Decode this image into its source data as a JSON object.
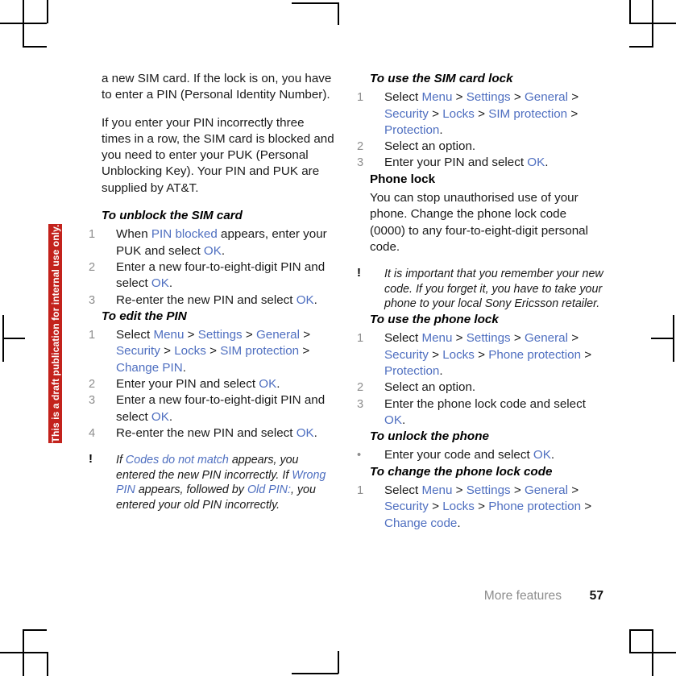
{
  "watermark": {
    "text": "This is a draft publication for internal use only.",
    "color": "#c3221c"
  },
  "colors": {
    "link": "#4f6fc0",
    "number": "#8d8d8d",
    "body": "#1a1a1a"
  },
  "left_column": {
    "paragraph_1": "a new SIM card. If the lock is on, you have to enter a PIN (Personal Identity Number).",
    "paragraph_2": "If you enter your PIN incorrectly three times in a row, the SIM card is blocked and you need to enter your PUK (Personal Unblocking Key). Your PIN and PUK are supplied by AT&T.",
    "section_unblock": {
      "heading": "To unblock the SIM card",
      "steps": [
        {
          "num": "1",
          "parts": [
            {
              "text": "When ",
              "style": "plain"
            },
            {
              "text": "PIN blocked",
              "style": "link"
            },
            {
              "text": " appears, enter your PUK and select ",
              "style": "plain"
            },
            {
              "text": "OK",
              "style": "link"
            },
            {
              "text": ".",
              "style": "plain"
            }
          ]
        },
        {
          "num": "2",
          "parts": [
            {
              "text": "Enter a new four-to-eight-digit PIN and select ",
              "style": "plain"
            },
            {
              "text": "OK",
              "style": "link"
            },
            {
              "text": ".",
              "style": "plain"
            }
          ]
        },
        {
          "num": "3",
          "parts": [
            {
              "text": "Re-enter the new PIN and select ",
              "style": "plain"
            },
            {
              "text": "OK",
              "style": "link"
            },
            {
              "text": ".",
              "style": "plain"
            }
          ]
        }
      ]
    },
    "section_edit_pin": {
      "heading": "To edit the PIN",
      "steps": [
        {
          "num": "1",
          "parts": [
            {
              "text": "Select ",
              "style": "plain"
            },
            {
              "text": "Menu",
              "style": "link"
            },
            {
              "text": " > ",
              "style": "sep"
            },
            {
              "text": "Settings",
              "style": "link"
            },
            {
              "text": " > ",
              "style": "sep"
            },
            {
              "text": "General",
              "style": "link"
            },
            {
              "text": " > ",
              "style": "sep"
            },
            {
              "text": "Security",
              "style": "link"
            },
            {
              "text": " > ",
              "style": "sep"
            },
            {
              "text": "Locks",
              "style": "link"
            },
            {
              "text": " > ",
              "style": "sep"
            },
            {
              "text": "SIM protection",
              "style": "link"
            },
            {
              "text": " > ",
              "style": "sep"
            },
            {
              "text": "Change PIN",
              "style": "link"
            },
            {
              "text": ".",
              "style": "plain"
            }
          ]
        },
        {
          "num": "2",
          "parts": [
            {
              "text": "Enter your PIN and select ",
              "style": "plain"
            },
            {
              "text": "OK",
              "style": "link"
            },
            {
              "text": ".",
              "style": "plain"
            }
          ]
        },
        {
          "num": "3",
          "parts": [
            {
              "text": "Enter a new four-to-eight-digit PIN and select ",
              "style": "plain"
            },
            {
              "text": "OK",
              "style": "link"
            },
            {
              "text": ".",
              "style": "plain"
            }
          ]
        },
        {
          "num": "4",
          "parts": [
            {
              "text": "Re-enter the new PIN and select ",
              "style": "plain"
            },
            {
              "text": "OK",
              "style": "link"
            },
            {
              "text": ".",
              "style": "plain"
            }
          ]
        }
      ]
    },
    "note": {
      "icon": "exclamation-icon",
      "parts": [
        {
          "text": "If ",
          "style": "plain"
        },
        {
          "text": "Codes do not match",
          "style": "link"
        },
        {
          "text": " appears, you entered the new PIN incorrectly. If ",
          "style": "plain"
        },
        {
          "text": "Wrong PIN",
          "style": "link"
        },
        {
          "text": " appears, followed by ",
          "style": "plain"
        },
        {
          "text": "Old PIN:",
          "style": "link"
        },
        {
          "text": ", you entered your old PIN incorrectly.",
          "style": "plain"
        }
      ]
    }
  },
  "right_column": {
    "section_sim_lock": {
      "heading": "To use the SIM card lock",
      "steps": [
        {
          "num": "1",
          "parts": [
            {
              "text": "Select ",
              "style": "plain"
            },
            {
              "text": "Menu",
              "style": "link"
            },
            {
              "text": " > ",
              "style": "sep"
            },
            {
              "text": "Settings",
              "style": "link"
            },
            {
              "text": " > ",
              "style": "sep"
            },
            {
              "text": "General",
              "style": "link"
            },
            {
              "text": " > ",
              "style": "sep"
            },
            {
              "text": "Security",
              "style": "link"
            },
            {
              "text": " > ",
              "style": "sep"
            },
            {
              "text": "Locks",
              "style": "link"
            },
            {
              "text": " > ",
              "style": "sep"
            },
            {
              "text": "SIM protection",
              "style": "link"
            },
            {
              "text": " > ",
              "style": "sep"
            },
            {
              "text": "Protection",
              "style": "link"
            },
            {
              "text": ".",
              "style": "plain"
            }
          ]
        },
        {
          "num": "2",
          "parts": [
            {
              "text": "Select an option.",
              "style": "plain"
            }
          ]
        },
        {
          "num": "3",
          "parts": [
            {
              "text": "Enter your PIN and select ",
              "style": "plain"
            },
            {
              "text": "OK",
              "style": "link"
            },
            {
              "text": ".",
              "style": "plain"
            }
          ]
        }
      ]
    },
    "section_phone_lock": {
      "heading": "Phone lock",
      "paragraph": "You can stop unauthorised use of your phone. Change the phone lock code (0000) to any four-to-eight-digit personal code.",
      "note": {
        "icon": "exclamation-icon",
        "parts": [
          {
            "text": "It is important that you remember your new code. If you forget it, you have to take your phone to your local Sony Ericsson retailer.",
            "style": "plain"
          }
        ]
      }
    },
    "section_use_phone_lock": {
      "heading": "To use the phone lock",
      "steps": [
        {
          "num": "1",
          "parts": [
            {
              "text": "Select ",
              "style": "plain"
            },
            {
              "text": "Menu",
              "style": "link"
            },
            {
              "text": " > ",
              "style": "sep"
            },
            {
              "text": "Settings",
              "style": "link"
            },
            {
              "text": " > ",
              "style": "sep"
            },
            {
              "text": "General",
              "style": "link"
            },
            {
              "text": " > ",
              "style": "sep"
            },
            {
              "text": "Security",
              "style": "link"
            },
            {
              "text": " > ",
              "style": "sep"
            },
            {
              "text": "Locks",
              "style": "link"
            },
            {
              "text": " > ",
              "style": "sep"
            },
            {
              "text": "Phone protection",
              "style": "link"
            },
            {
              "text": " > ",
              "style": "sep"
            },
            {
              "text": "Protection",
              "style": "link"
            },
            {
              "text": ".",
              "style": "plain"
            }
          ]
        },
        {
          "num": "2",
          "parts": [
            {
              "text": "Select an option.",
              "style": "plain"
            }
          ]
        },
        {
          "num": "3",
          "parts": [
            {
              "text": "Enter the phone lock code and select ",
              "style": "plain"
            },
            {
              "text": "OK",
              "style": "link"
            },
            {
              "text": ".",
              "style": "plain"
            }
          ]
        }
      ]
    },
    "section_unlock_phone": {
      "heading": "To unlock the phone",
      "steps": [
        {
          "num": "•",
          "parts": [
            {
              "text": "Enter your code and select ",
              "style": "plain"
            },
            {
              "text": "OK",
              "style": "link"
            },
            {
              "text": ".",
              "style": "plain"
            }
          ]
        }
      ]
    },
    "section_change_code": {
      "heading": "To change the phone lock code",
      "steps": [
        {
          "num": "1",
          "parts": [
            {
              "text": "Select ",
              "style": "plain"
            },
            {
              "text": "Menu",
              "style": "link"
            },
            {
              "text": " > ",
              "style": "sep"
            },
            {
              "text": "Settings",
              "style": "link"
            },
            {
              "text": " > ",
              "style": "sep"
            },
            {
              "text": "General",
              "style": "link"
            },
            {
              "text": " > ",
              "style": "sep"
            },
            {
              "text": "Security",
              "style": "link"
            },
            {
              "text": " > ",
              "style": "sep"
            },
            {
              "text": "Locks",
              "style": "link"
            },
            {
              "text": " > ",
              "style": "sep"
            },
            {
              "text": "Phone protection",
              "style": "link"
            },
            {
              "text": " > ",
              "style": "sep"
            },
            {
              "text": "Change code",
              "style": "link"
            },
            {
              "text": ".",
              "style": "plain"
            }
          ]
        }
      ]
    }
  },
  "footer": {
    "chapter": "More features",
    "page_number": "57"
  }
}
